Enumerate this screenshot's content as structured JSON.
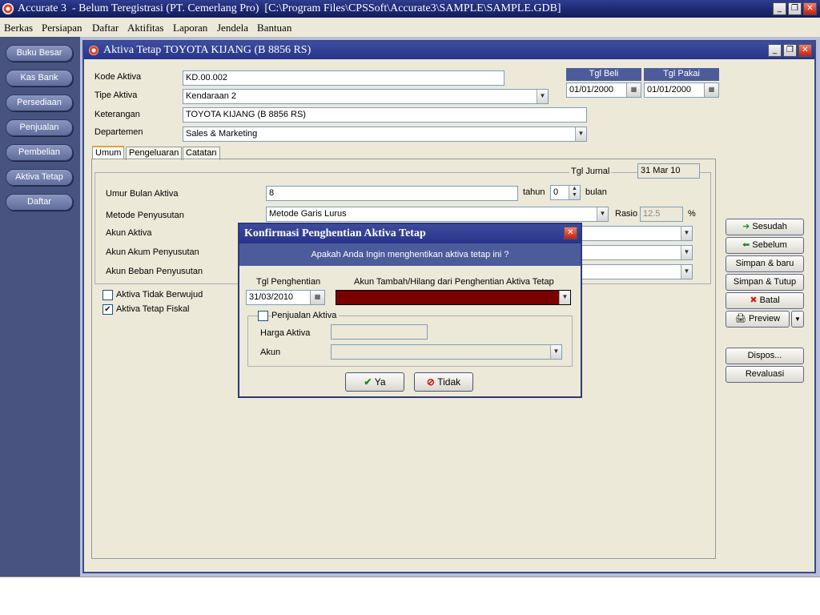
{
  "app": {
    "title": "Accurate 3  - Belum Teregistrasi (PT. Cemerlang Pro)  [C:\\Program Files\\CPSSoft\\Accurate3\\SAMPLE\\SAMPLE.GDB]",
    "win_min": "_",
    "win_restore": "❐",
    "win_close": "✕"
  },
  "menu": [
    "Berkas",
    "Persiapan",
    "Daftar",
    "Aktifitas",
    "Laporan",
    "Jendela",
    "Bantuan"
  ],
  "nav": [
    "Buku Besar",
    "Kas Bank",
    "Persediaan",
    "Penjualan",
    "Pembelian",
    "Aktiva Tetap",
    "Daftar"
  ],
  "form": {
    "title": "Aktiva Tetap TOYOTA KIJANG (B 8856 RS)",
    "kode_label": "Kode Aktiva",
    "kode_value": "KD.00.002",
    "tipe_label": "Tipe Aktiva",
    "tipe_value": "Kendaraan 2",
    "ket_label": "Keterangan",
    "ket_value": "TOYOTA KIJANG (B 8856 RS)",
    "dept_label": "Departemen",
    "dept_value": "Sales & Marketing",
    "tgl_beli_label": "Tgl Beli",
    "tgl_beli_value": "01/01/2000",
    "tgl_pakai_label": "Tgl Pakai",
    "tgl_pakai_value": "01/01/2000",
    "tabs": [
      "Umum",
      "Pengeluaran",
      "Catatan"
    ],
    "tgl_jurnal_label": "Tgl Jurnal",
    "tgl_jurnal_value": "31 Mar 10",
    "umur_label": "Umur Bulan Aktiva",
    "umur_value": "8",
    "tahun_label": "tahun",
    "tahun_value": "0",
    "bulan_label": "bulan",
    "metode_label": "Metode Penyusutan",
    "metode_value": "Metode Garis Lurus",
    "rasio_label": "Rasio",
    "rasio_value": "12.5",
    "pct": "%",
    "akun_aktiva_label": "Akun Aktiva",
    "akun_akum_label": "Akun Akum Penyusutan",
    "akun_beban_label": "Akun Beban Penyusutan",
    "chk_tidak_berwujud": "Aktiva Tidak Berwujud",
    "chk_fiskal": "Aktiva Tetap Fiskal"
  },
  "side_buttons": [
    "Sesudah",
    "Sebelum",
    "Simpan & baru",
    "Simpan & Tutup",
    "Batal",
    "Preview",
    "Dispos...",
    "Revaluasi"
  ],
  "dialog": {
    "title": "Konfirmasi Penghentian Aktiva Tetap",
    "question": "Apakah Anda Ingin menghentikan aktiva tetap ini ?",
    "tgl_label": "Tgl Penghentian",
    "tgl_value": "31/03/2010",
    "akun_label": "Akun Tambah/Hilang dari Penghentian Aktiva Tetap",
    "penjualan_label": "Penjualan Aktiva",
    "harga_label": "Harga Aktiva",
    "akun2_label": "Akun",
    "ya_label": "Ya",
    "tidak_label": "Tidak",
    "close": "✕"
  },
  "colors": {
    "accent": "#3e4d9e",
    "nav_bg": "#48537f",
    "selected_dropdown": "#7a0000",
    "window_face": "#ece9d8"
  }
}
